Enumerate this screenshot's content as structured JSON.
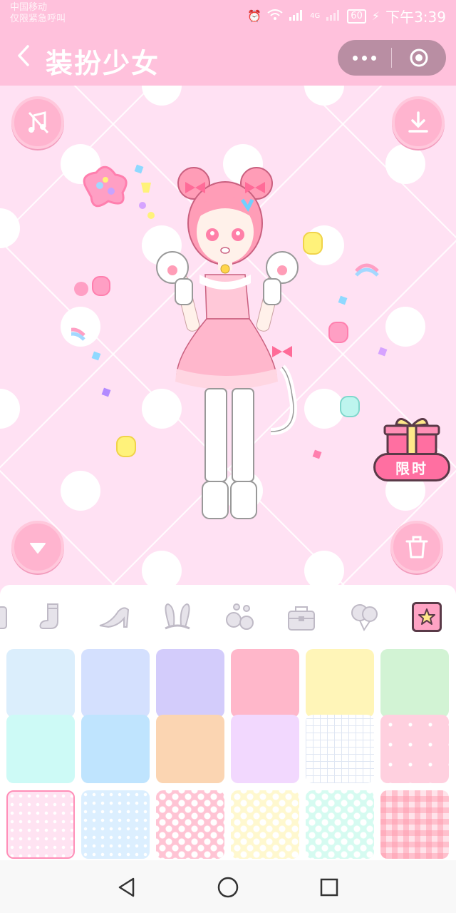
{
  "status_bar": {
    "carrier_line1": "中国移动",
    "carrier_line2": "仅限紧急呼叫",
    "network": "4G",
    "battery": "60",
    "time": "下午3:39"
  },
  "nav": {
    "title": "装扮少女"
  },
  "stage": {
    "limited_label": "限时"
  },
  "tabs": [
    {
      "icon": "partial-item-icon"
    },
    {
      "icon": "sock-icon"
    },
    {
      "icon": "high-heel-icon"
    },
    {
      "icon": "bunny-ears-icon"
    },
    {
      "icon": "pets-icon"
    },
    {
      "icon": "bag-icon"
    },
    {
      "icon": "balloons-icon"
    },
    {
      "icon": "star-background-icon",
      "active": true
    }
  ],
  "backgrounds": [
    {
      "name": "light-blue",
      "color": "#dbeefc",
      "pattern": "solid"
    },
    {
      "name": "periwinkle",
      "color": "#d4e0fe",
      "pattern": "solid"
    },
    {
      "name": "lavender",
      "color": "#d3ccfb",
      "pattern": "solid"
    },
    {
      "name": "pink",
      "color": "#ffb7ca",
      "pattern": "solid"
    },
    {
      "name": "yellow",
      "color": "#fff5b8",
      "pattern": "solid"
    },
    {
      "name": "mint-green",
      "color": "#d2f3d4",
      "pattern": "solid"
    },
    {
      "name": "aqua",
      "color": "#cdfaf6",
      "pattern": "solid"
    },
    {
      "name": "sky-blue",
      "color": "#bfe4fe",
      "pattern": "solid"
    },
    {
      "name": "peach",
      "color": "#fbd5b2",
      "pattern": "solid"
    },
    {
      "name": "lilac",
      "color": "#f2d8fe",
      "pattern": "solid"
    },
    {
      "name": "grid-white",
      "color": "#ffffff",
      "pattern": "grid"
    },
    {
      "name": "pink-stars",
      "color": "#ffd0df",
      "pattern": "stars"
    },
    {
      "name": "pink-dots-small",
      "color": "#ffe3f2",
      "pattern": "dots-small",
      "selected": true
    },
    {
      "name": "blue-dots-small",
      "color": "#dcefff",
      "pattern": "dots-small"
    },
    {
      "name": "pink-polka",
      "color": "#ffc4d4",
      "pattern": "polka"
    },
    {
      "name": "yellow-polka",
      "color": "#fff8cf",
      "pattern": "polka"
    },
    {
      "name": "mint-polka",
      "color": "#d6fbf1",
      "pattern": "polka"
    },
    {
      "name": "pink-gingham",
      "color": "#ffe3ea",
      "pattern": "gingham"
    }
  ],
  "colors": {
    "header": "#ffc1dc",
    "stage_bg": "#ffe1f3",
    "button": "#ffb4cf",
    "accent": "#ff6fa1"
  }
}
